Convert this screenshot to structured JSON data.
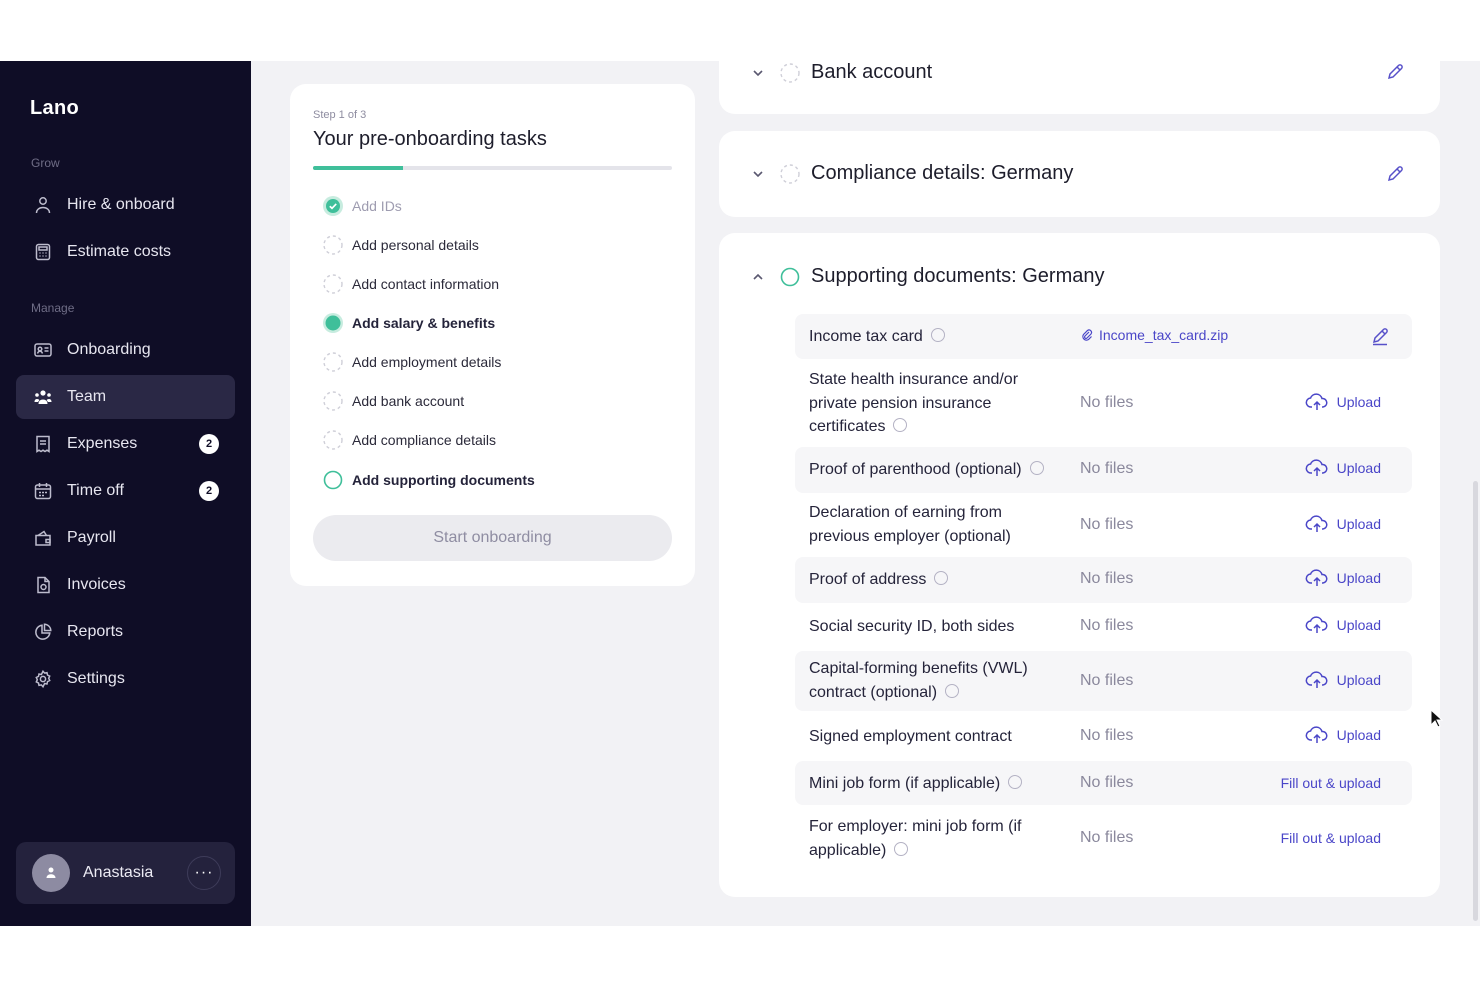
{
  "app": {
    "logo": "Lano"
  },
  "sidebar": {
    "sections": {
      "grow": "Grow",
      "manage": "Manage"
    },
    "items": [
      {
        "label": "Hire & onboard",
        "icon": "person-plus-icon"
      },
      {
        "label": "Estimate costs",
        "icon": "calculator-icon"
      },
      {
        "label": "Onboarding",
        "icon": "id-card-icon"
      },
      {
        "label": "Team",
        "icon": "team-icon",
        "active": true
      },
      {
        "label": "Expenses",
        "icon": "receipt-icon",
        "badge": "2"
      },
      {
        "label": "Time off",
        "icon": "calendar-icon",
        "badge": "2"
      },
      {
        "label": "Payroll",
        "icon": "wallet-icon"
      },
      {
        "label": "Invoices",
        "icon": "invoice-icon"
      },
      {
        "label": "Reports",
        "icon": "pie-chart-icon"
      },
      {
        "label": "Settings",
        "icon": "gear-icon"
      }
    ],
    "user": {
      "name": "Anastasia",
      "more": "···"
    }
  },
  "tasks": {
    "step": "Step 1 of 3",
    "title": "Your pre-onboarding tasks",
    "progress": 0.25,
    "items": [
      {
        "label": "Add IDs",
        "state": "done"
      },
      {
        "label": "Add personal details",
        "state": "pending"
      },
      {
        "label": "Add contact information",
        "state": "pending"
      },
      {
        "label": "Add salary & benefits",
        "state": "active"
      },
      {
        "label": "Add employment details",
        "state": "pending"
      },
      {
        "label": "Add bank account",
        "state": "pending"
      },
      {
        "label": "Add compliance details",
        "state": "pending"
      },
      {
        "label": "Add supporting documents",
        "state": "current"
      }
    ],
    "start_button": "Start onboarding"
  },
  "panels": {
    "bank": {
      "title": "Bank account"
    },
    "compliance": {
      "title": "Compliance details: Germany"
    },
    "documents": {
      "title": "Supporting documents: Germany",
      "rows": [
        {
          "label": "Income tax card",
          "info": true,
          "file": "Income_tax_card.zip",
          "action": "edit"
        },
        {
          "label": "State health insurance and/or private pension insurance certificates",
          "info": true,
          "files": "No files",
          "action": "Upload"
        },
        {
          "label": "Proof of parenthood (optional)",
          "info": true,
          "files": "No files",
          "action": "Upload"
        },
        {
          "label": "Declaration of earning from previous employer (optional)",
          "info": false,
          "files": "No files",
          "action": "Upload"
        },
        {
          "label": "Proof of address",
          "info": true,
          "files": "No files",
          "action": "Upload"
        },
        {
          "label": "Social security ID, both sides",
          "info": false,
          "files": "No files",
          "action": "Upload"
        },
        {
          "label": "Capital-forming benefits (VWL) contract (optional)",
          "info": true,
          "files": "No files",
          "action": "Upload"
        },
        {
          "label": "Signed employment contract",
          "info": false,
          "files": "No files",
          "action": "Upload"
        },
        {
          "label": "Mini job form (if applicable)",
          "info": true,
          "files": "No files",
          "action": "Fill out & upload"
        },
        {
          "label": "For employer: mini job form (if applicable)",
          "info": true,
          "files": "No files",
          "action": "Fill out & upload"
        }
      ]
    }
  },
  "colors": {
    "accent": "#4a46c8",
    "success": "#3fbf9a",
    "sidebar": "#0f0d26"
  }
}
